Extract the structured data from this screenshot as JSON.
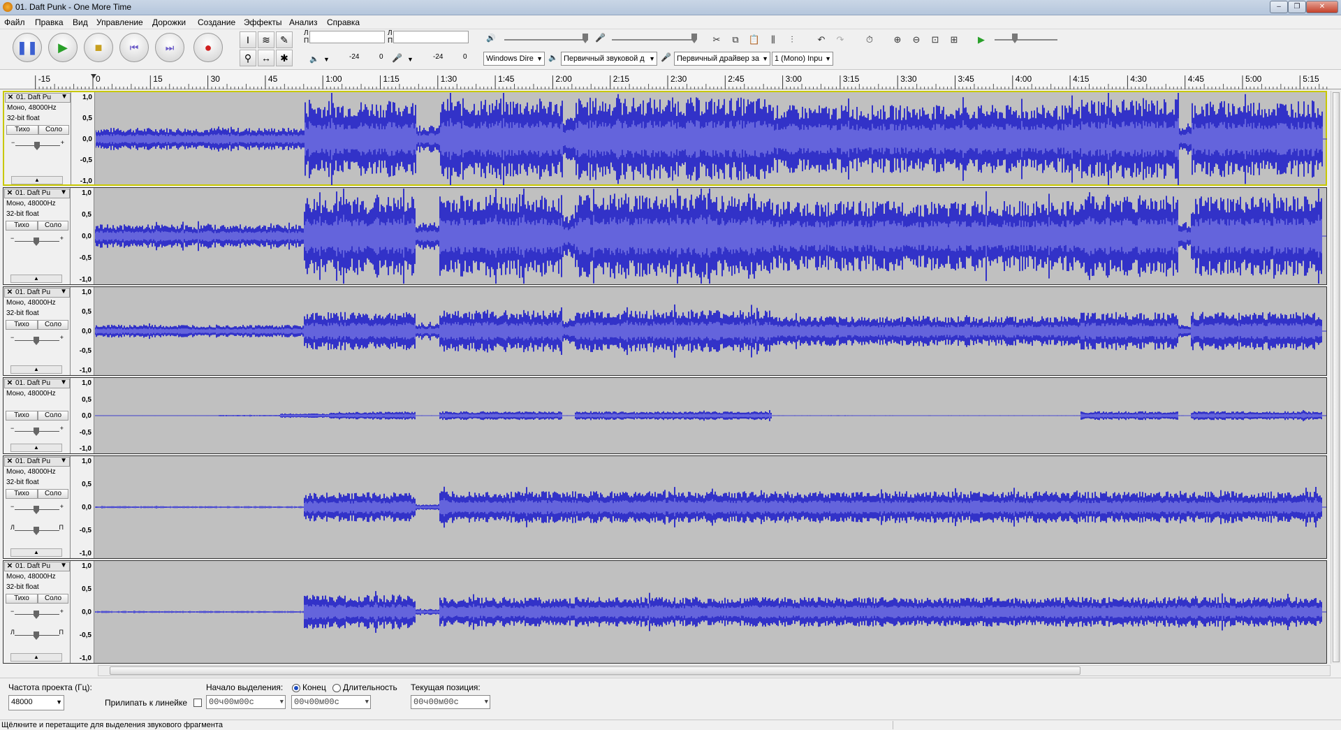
{
  "window": {
    "title": "01. Daft Punk - One More Time",
    "controls": [
      "–",
      "❐",
      "✕"
    ]
  },
  "menu": [
    "Файл",
    "Правка",
    "Вид",
    "Управление",
    "Дорожки",
    "Создание",
    "Эффекты",
    "Анализ",
    "Справка"
  ],
  "meters": {
    "left_channel": "Л",
    "right_channel": "П",
    "play_db": "-24",
    "play_zero": "0",
    "rec_db": "-24",
    "rec_zero": "0"
  },
  "devices": {
    "host": "Windows Dire",
    "output": "Первичный звуковой д",
    "input": "Первичный драйвер за",
    "channels": "1 (Mono) Inpu"
  },
  "ruler": {
    "labels": [
      "-15",
      "0",
      "15",
      "30",
      "45",
      "1:00",
      "1:15",
      "1:30",
      "1:45",
      "2:00",
      "2:15",
      "2:30",
      "2:45",
      "3:00",
      "3:15",
      "3:30",
      "3:45",
      "4:00",
      "4:15",
      "4:30",
      "4:45",
      "5:00",
      "5:15"
    ]
  },
  "tracks": [
    {
      "name": "01. Daft Pu",
      "format": "Моно, 48000Hz",
      "bits": "32-bit float",
      "mute": "Тихо",
      "solo": "Соло",
      "selected": true,
      "pan": false
    },
    {
      "name": "01. Daft Pu",
      "format": "Моно, 48000Hz",
      "bits": "32-bit float",
      "mute": "Тихо",
      "solo": "Соло",
      "selected": false,
      "pan": false
    },
    {
      "name": "01. Daft Pu",
      "format": "Моно, 48000Hz",
      "bits": "32-bit float",
      "mute": "Тихо",
      "solo": "Соло",
      "selected": false,
      "pan": false
    },
    {
      "name": "01. Daft Pu",
      "format": "Моно, 48000Hz",
      "bits": "",
      "mute": "Тихо",
      "solo": "Соло",
      "selected": false,
      "pan": false
    },
    {
      "name": "01. Daft Pu",
      "format": "Моно, 48000Hz",
      "bits": "32-bit float",
      "mute": "Тихо",
      "solo": "Соло",
      "selected": false,
      "pan": true
    },
    {
      "name": "01. Daft Pu",
      "format": "Моно, 48000Hz",
      "bits": "32-bit float",
      "mute": "Тихо",
      "solo": "Соло",
      "selected": false,
      "pan": true
    }
  ],
  "scale_labels": [
    "1,0",
    "0,5",
    "0,0",
    "-0,5",
    "-1,0"
  ],
  "selection": {
    "rate_label": "Частота проекта (Гц):",
    "rate_value": "48000",
    "snap_label": "Прилипать к линейке",
    "start_label": "Начало выделения:",
    "end_option": "Конец",
    "length_option": "Длительность",
    "position_label": "Текущая позиция:",
    "start_time": "00ч00м00с",
    "end_time": "00ч00м00с",
    "position_time": "00ч00м00с"
  },
  "status": "Щёлкните и перетащите для выделения звукового фрагмента",
  "colors": {
    "wave": "#3232c8",
    "wave_core": "#6464dc",
    "track_bg": "#c0c0c0",
    "selected_border": "#c8c800"
  }
}
